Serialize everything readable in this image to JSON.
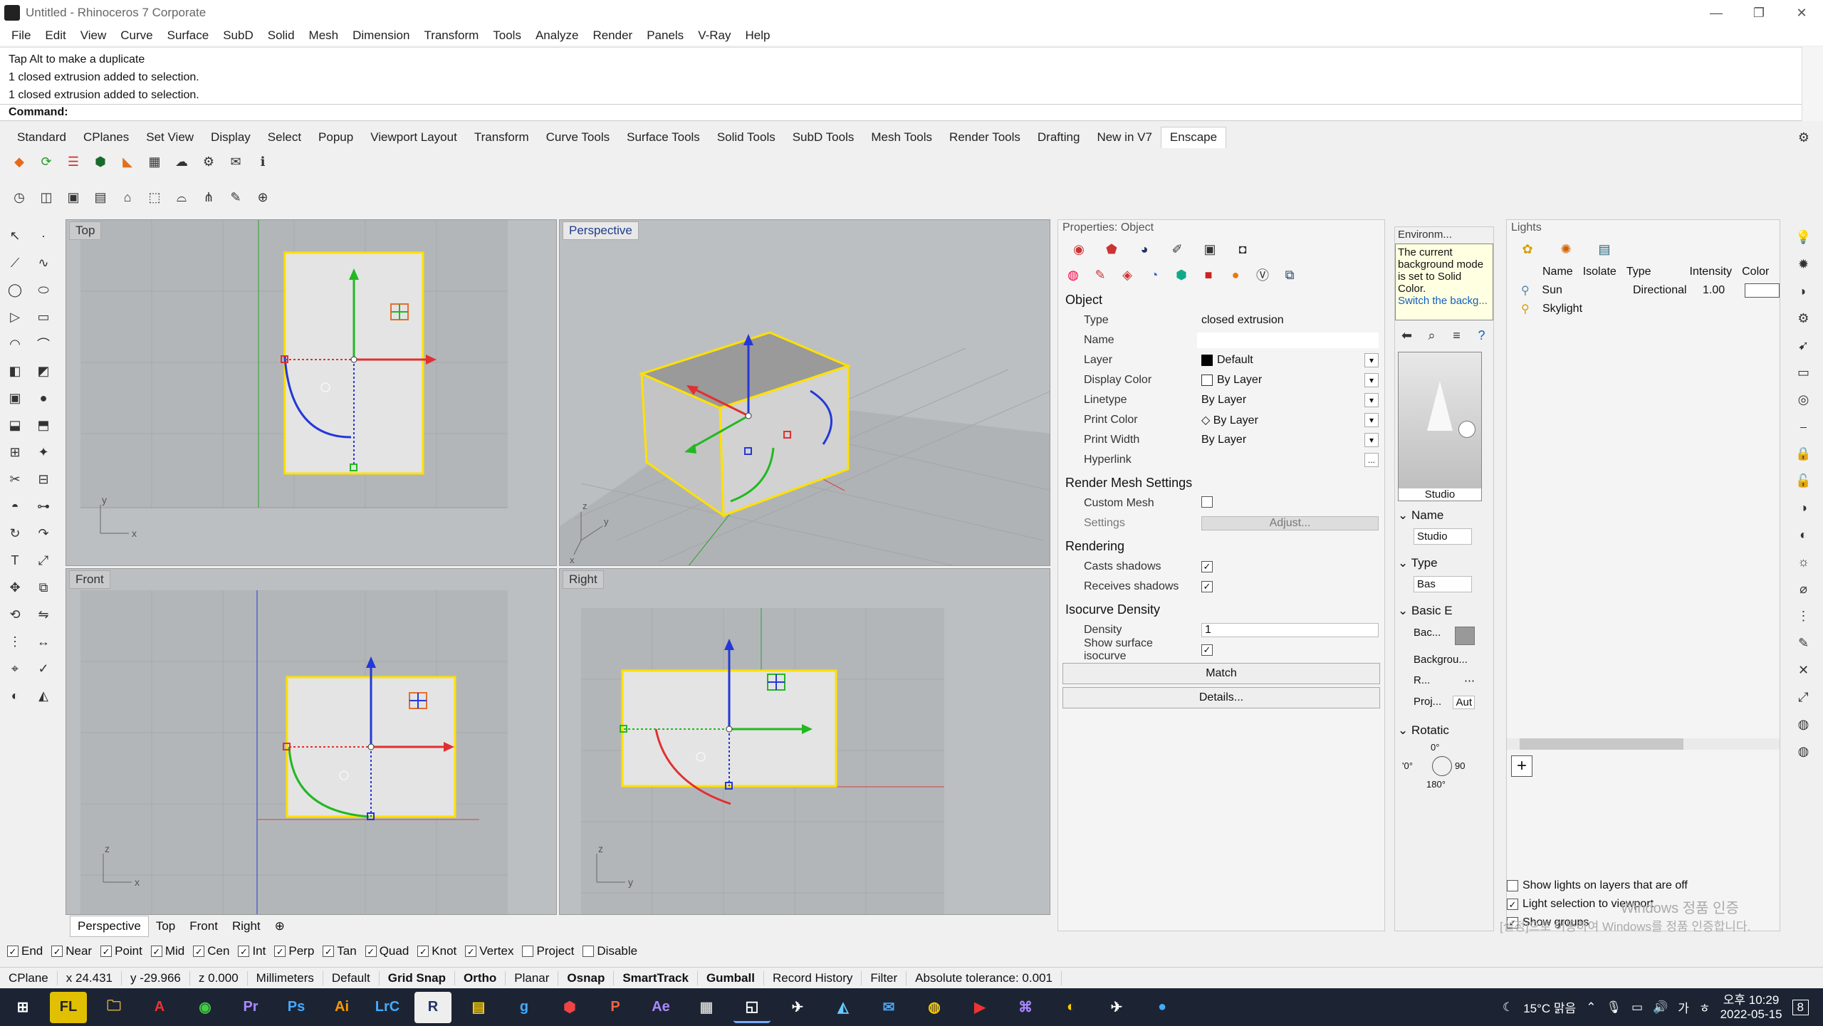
{
  "window": {
    "title": "Untitled - Rhinoceros 7 Corporate",
    "minimize": "—",
    "maximize": "❐",
    "close": "✕"
  },
  "menu": [
    "File",
    "Edit",
    "View",
    "Curve",
    "Surface",
    "SubD",
    "Solid",
    "Mesh",
    "Dimension",
    "Transform",
    "Tools",
    "Analyze",
    "Render",
    "Panels",
    "V-Ray",
    "Help"
  ],
  "command_history": [
    "Tap Alt to make a duplicate",
    "1 closed extrusion added to selection.",
    "1 closed extrusion added to selection."
  ],
  "command_prompt": "Command:",
  "toolbar_tabs": [
    "Standard",
    "CPlanes",
    "Set View",
    "Display",
    "Select",
    "Popup",
    "Viewport Layout",
    "Transform",
    "Curve Tools",
    "Surface Tools",
    "Solid Tools",
    "SubD Tools",
    "Mesh Tools",
    "Render Tools",
    "Drafting",
    "New in V7",
    "Enscape"
  ],
  "active_toolbar_tab": "Enscape",
  "viewports": {
    "top": "Top",
    "perspective": "Perspective",
    "front": "Front",
    "right": "Right"
  },
  "viewport_tabs": [
    "Perspective",
    "Top",
    "Front",
    "Right"
  ],
  "viewport_add": "⊕",
  "osnaps": [
    {
      "label": "End",
      "checked": true
    },
    {
      "label": "Near",
      "checked": true
    },
    {
      "label": "Point",
      "checked": true
    },
    {
      "label": "Mid",
      "checked": true
    },
    {
      "label": "Cen",
      "checked": true
    },
    {
      "label": "Int",
      "checked": true
    },
    {
      "label": "Perp",
      "checked": true
    },
    {
      "label": "Tan",
      "checked": true
    },
    {
      "label": "Quad",
      "checked": true
    },
    {
      "label": "Knot",
      "checked": true
    },
    {
      "label": "Vertex",
      "checked": true
    },
    {
      "label": "Project",
      "checked": false
    },
    {
      "label": "Disable",
      "checked": false
    }
  ],
  "status": {
    "cplane": "CPlane",
    "x": "x 24.431",
    "y": "y -29.966",
    "z": "z 0.000",
    "units": "Millimeters",
    "layer": "Default",
    "grid_snap": "Grid Snap",
    "ortho": "Ortho",
    "planar": "Planar",
    "osnap": "Osnap",
    "smarttrack": "SmartTrack",
    "gumball": "Gumball",
    "record_history": "Record History",
    "filter": "Filter",
    "tolerance": "Absolute tolerance: 0.001"
  },
  "properties": {
    "header": "Properties: Object",
    "section_object": "Object",
    "rows": [
      {
        "k": "Type",
        "v": "closed extrusion"
      },
      {
        "k": "Name",
        "v": ""
      },
      {
        "k": "Layer",
        "v": "Default"
      },
      {
        "k": "Display Color",
        "v": "By Layer"
      },
      {
        "k": "Linetype",
        "v": "By Layer"
      },
      {
        "k": "Print Color",
        "v": "By Layer"
      },
      {
        "k": "Print Width",
        "v": "By Layer"
      },
      {
        "k": "Hyperlink",
        "v": "..."
      }
    ],
    "section_mesh": "Render Mesh Settings",
    "custom_mesh": "Custom Mesh",
    "settings": "Settings",
    "adjust": "Adjust...",
    "section_rendering": "Rendering",
    "casts_shadows": "Casts shadows",
    "receives_shadows": "Receives shadows",
    "section_isocurve": "Isocurve Density",
    "density_label": "Density",
    "density_value": "1",
    "show_isocurve": "Show surface isocurve",
    "match": "Match",
    "details": "Details..."
  },
  "environment": {
    "tab": "Environm...",
    "tooltip": "The current background mode is set to Solid Color.",
    "tooltip_link": "Switch the backg...",
    "preview_label": "Studio",
    "name_hdr": "Name",
    "name_value": "Studio",
    "type_hdr": "Type",
    "type_value": "Bas",
    "basic_hdr": "Basic E",
    "bac": "Bac...",
    "backgrou": "Backgrou...",
    "r": "R...",
    "proj": "Proj...",
    "aut": "Aut",
    "rotation_hdr": "Rotatic",
    "rot_top": "0°",
    "rot_left": "'0°",
    "rot_right": "90",
    "rot_bottom": "180°"
  },
  "lights": {
    "header": "Lights",
    "columns": [
      "Name",
      "Isolate",
      "Type",
      "Intensity",
      "Color"
    ],
    "rows": [
      {
        "name": "Sun",
        "isolate": "",
        "type": "Directional",
        "intensity": "1.00"
      },
      {
        "name": "Skylight",
        "isolate": "",
        "type": "",
        "intensity": ""
      }
    ],
    "add": "+",
    "show_lights_off": "Show lights on layers that are off",
    "light_selection": "Light selection to viewport",
    "show_groups": "Show groups",
    "watermark1": "Windows 정품 인증",
    "watermark2": "[설정]으로 이동하여 Windows를 정품 인증합니다."
  },
  "taskbar": {
    "apps": [
      "⊞",
      "FL",
      "🗀",
      "A",
      "◉",
      "Pr",
      "Ps",
      "Ai",
      "LrC",
      "R",
      "▤",
      "g",
      "⬢",
      "P",
      "Ae",
      "▦",
      "◱",
      "✈",
      "◭",
      "✉",
      "◍",
      "▶",
      "⌘",
      "◐",
      "✈",
      "●"
    ],
    "weather": "15°C 맑음",
    "time": "오후 10:29",
    "date": "2022-05-15",
    "lang": "가",
    "notif": "8"
  },
  "colors": {
    "viewport_bg": "#bcbfc2",
    "grid": "#a9acaf",
    "object_edge": "#ffee00",
    "x_axis": "#e82c2c",
    "y_axis": "#22c322",
    "z_axis": "#1c3fe0"
  }
}
